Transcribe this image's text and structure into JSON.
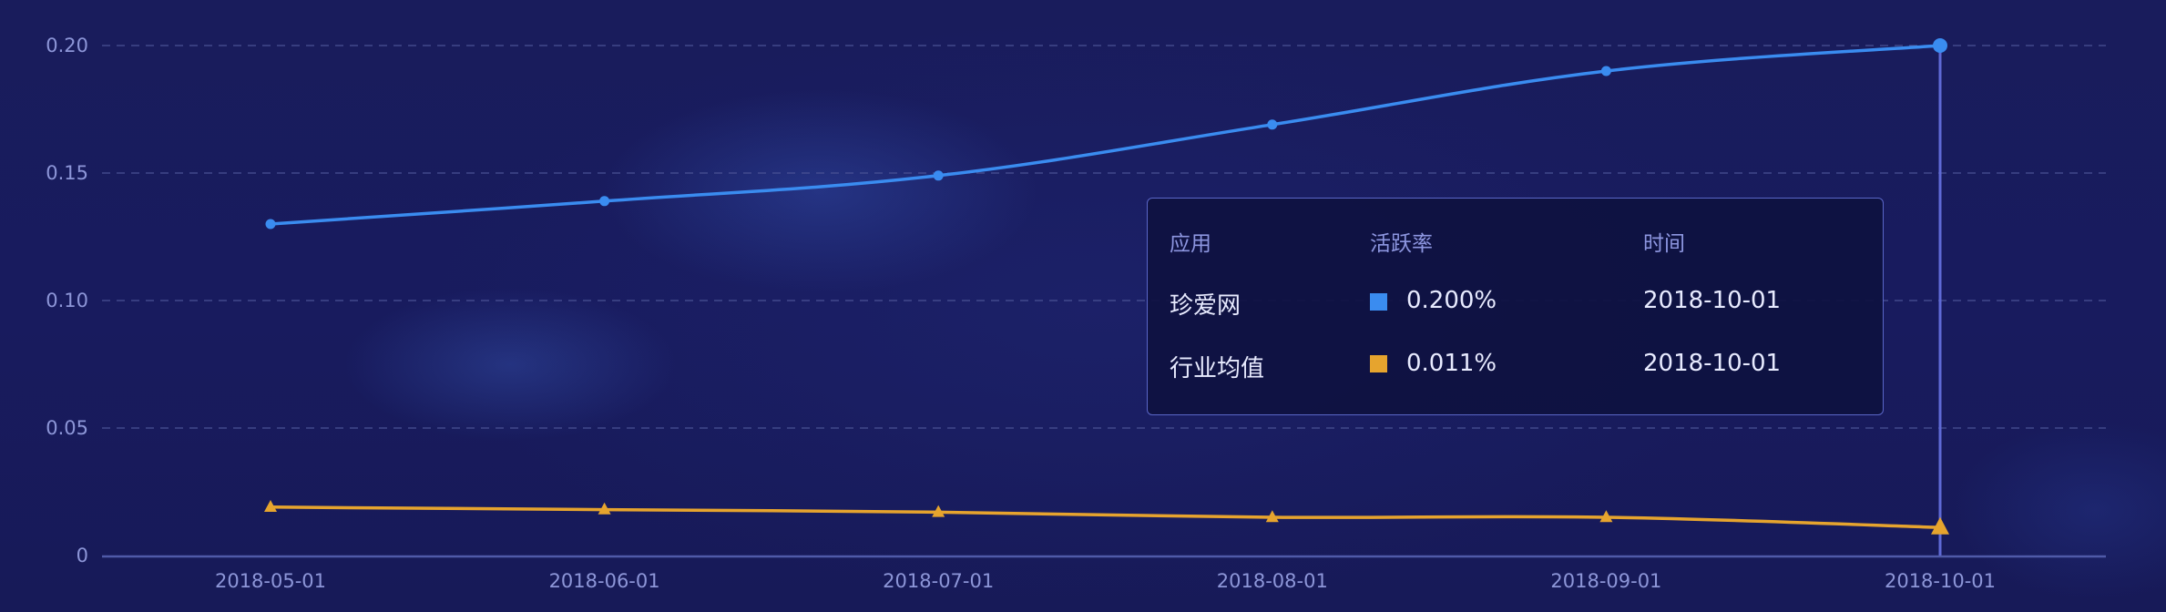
{
  "chart_data": {
    "type": "line",
    "title": "",
    "xlabel": "",
    "ylabel": "",
    "categories": [
      "2018-05-01",
      "2018-06-01",
      "2018-07-01",
      "2018-08-01",
      "2018-09-01",
      "2018-10-01"
    ],
    "y_ticks": [
      "0",
      "0.05",
      "0.10",
      "0.15",
      "0.20"
    ],
    "y_tick_values": [
      0,
      0.05,
      0.1,
      0.15,
      0.2
    ],
    "ylim": [
      0,
      0.2
    ],
    "grid": "horizontal-dashed",
    "series": [
      {
        "name": "珍爱网",
        "color": "#3a8cf0",
        "marker": "circle",
        "values": [
          0.13,
          0.139,
          0.149,
          0.169,
          0.19,
          0.2
        ]
      },
      {
        "name": "行业均值",
        "color": "#e6a42e",
        "marker": "triangle",
        "values": [
          0.019,
          0.018,
          0.017,
          0.015,
          0.015,
          0.011
        ]
      }
    ],
    "highlighted_index": 5
  },
  "tooltip": {
    "headers": [
      "应用",
      "活跃率",
      "时间"
    ],
    "rows": [
      {
        "app": "珍爱网",
        "rate": "0.200%",
        "time": "2018-10-01",
        "color": "#3a8cf0"
      },
      {
        "app": "行业均值",
        "rate": "0.011%",
        "time": "2018-10-01",
        "color": "#e6a42e"
      }
    ]
  }
}
